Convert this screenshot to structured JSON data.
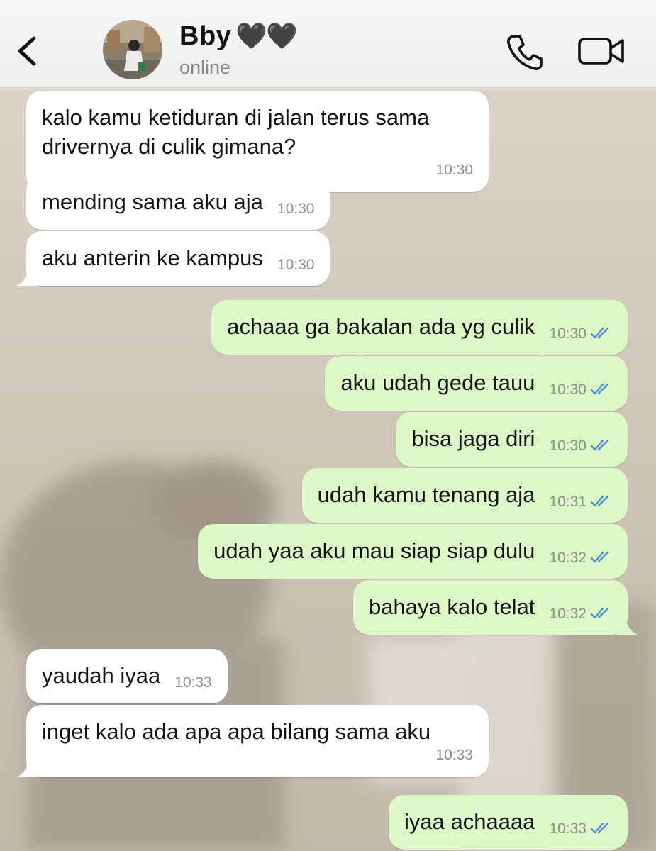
{
  "header": {
    "contact_name": "Bby",
    "contact_hearts": "🖤🖤",
    "status": "online"
  },
  "icons": {
    "back": "chevron-left-icon",
    "call": "phone-icon",
    "video": "video-camera-icon",
    "read_receipt": "double-check-icon"
  },
  "colors": {
    "incoming_bubble": "#ffffff",
    "outgoing_bubble": "#dcf8c6",
    "read_tick": "#4f8fd8",
    "status_text": "#8a8a8e"
  },
  "messages": [
    {
      "direction": "in",
      "text": "kalo kamu ketiduran di jalan terus sama drivernya di culik gimana?",
      "time": "10:30"
    },
    {
      "direction": "in",
      "text": "mending sama aku aja",
      "time": "10:30"
    },
    {
      "direction": "in",
      "text": "aku anterin ke kampus",
      "time": "10:30"
    },
    {
      "direction": "out",
      "text": "achaaa ga bakalan ada yg culik",
      "time": "10:30",
      "read": true
    },
    {
      "direction": "out",
      "text": "aku udah gede tauu",
      "time": "10:30",
      "read": true
    },
    {
      "direction": "out",
      "text": "bisa jaga diri",
      "time": "10:30",
      "read": true
    },
    {
      "direction": "out",
      "text": "udah kamu tenang aja",
      "time": "10:31",
      "read": true
    },
    {
      "direction": "out",
      "text": "udah yaa aku mau siap siap dulu",
      "time": "10:32",
      "read": true
    },
    {
      "direction": "out",
      "text": "bahaya kalo telat",
      "time": "10:32",
      "read": true
    },
    {
      "direction": "in",
      "text": "yaudah iyaa",
      "time": "10:33"
    },
    {
      "direction": "in",
      "text": "inget kalo ada apa apa bilang sama aku",
      "time": "10:33"
    },
    {
      "direction": "out",
      "text": "iyaa achaaaa",
      "time": "10:33",
      "read": true
    }
  ]
}
